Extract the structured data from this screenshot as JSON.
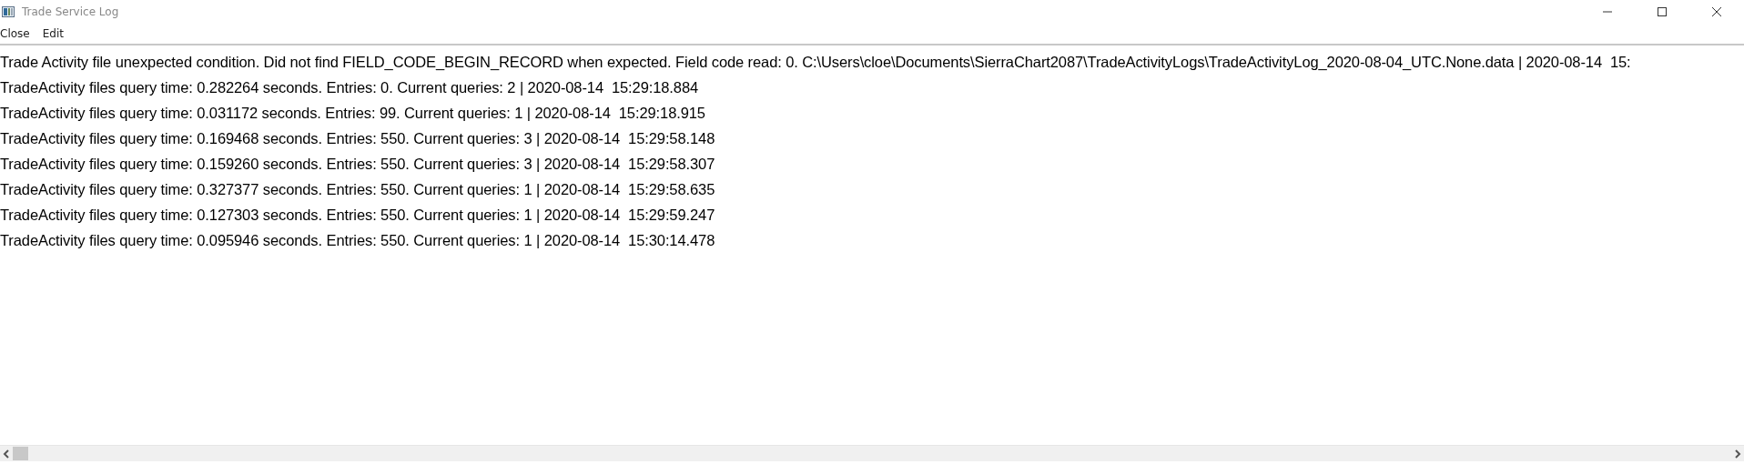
{
  "window": {
    "title": "Trade Service Log"
  },
  "menu": [
    "Close",
    "Edit"
  ],
  "log_lines": [
    "Trade Activity file unexpected condition. Did not find FIELD_CODE_BEGIN_RECORD when expected. Field code read: 0. C:\\Users\\cloe\\Documents\\SierraChart2087\\TradeActivityLogs\\TradeActivityLog_2020-08-04_UTC.None.data | 2020-08-14  15:",
    "TradeActivity files query time: 0.282264 seconds. Entries: 0. Current queries: 2 | 2020-08-14  15:29:18.884",
    "TradeActivity files query time: 0.031172 seconds. Entries: 99. Current queries: 1 | 2020-08-14  15:29:18.915",
    "TradeActivity files query time: 0.169468 seconds. Entries: 550. Current queries: 3 | 2020-08-14  15:29:58.148",
    "TradeActivity files query time: 0.159260 seconds. Entries: 550. Current queries: 3 | 2020-08-14  15:29:58.307",
    "TradeActivity files query time: 0.327377 seconds. Entries: 550. Current queries: 1 | 2020-08-14  15:29:58.635",
    "TradeActivity files query time: 0.127303 seconds. Entries: 550. Current queries: 1 | 2020-08-14  15:29:59.247",
    "TradeActivity files query time: 0.095946 seconds. Entries: 550. Current queries: 1 | 2020-08-14  15:30:14.478"
  ]
}
